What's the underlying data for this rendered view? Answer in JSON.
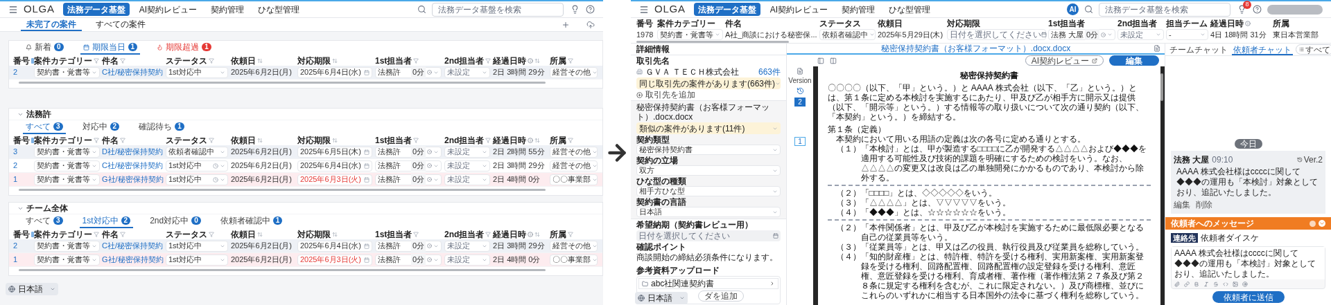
{
  "left": {
    "nav": {
      "logo": "OLGA",
      "menu": [
        {
          "label": "法務データ基盤",
          "selected": true
        },
        {
          "label": "AI契約レビュー",
          "selected": false
        },
        {
          "label": "契約管理",
          "selected": false
        },
        {
          "label": "ひな型管理",
          "selected": false
        }
      ],
      "search": {
        "placeholder": "法務データ基盤を検索"
      }
    },
    "tabs": [
      {
        "label": "未完了の案件",
        "selected": true
      },
      {
        "label": "すべての案件",
        "selected": false
      }
    ],
    "sections": [
      {
        "tabs": [
          {
            "label": "新着",
            "count": "0",
            "kind": "new",
            "selected": false
          },
          {
            "label": "期限当日",
            "count": "1",
            "kind": "today",
            "selected": true
          },
          {
            "label": "期限超過",
            "count": "1",
            "kind": "overdue",
            "selected": false
          }
        ],
        "columns": [
          "番号",
          "案件カテゴリー",
          "件名",
          "ステータス",
          "依頼日",
          "対応期限",
          "1st担当者",
          "2nd担当者",
          "経過日時",
          "所属"
        ],
        "rows": [
          {
            "no": "2",
            "category": "契約書・覚書等",
            "title": "C社/秘密保持契約",
            "status": "1st対応中",
            "status_clock": false,
            "date": "2025年6月2日(月)",
            "deadline": "2025年6月4日(水)",
            "overdue": false,
            "first": "法務許",
            "first_time": "0分",
            "second": "未設定",
            "elapsed": "2日 3時間 29分",
            "dept": "経営その他",
            "selected": true
          }
        ]
      },
      {
        "title": "法務許",
        "tabs": [
          {
            "label": "すべて",
            "count": "3",
            "kind": "plain",
            "selected": true
          },
          {
            "label": "対応中",
            "count": "2",
            "kind": "plain",
            "selected": false
          },
          {
            "label": "確認待ち",
            "count": "1",
            "kind": "plain",
            "selected": false
          }
        ],
        "columns": [
          "番号",
          "案件カテゴリー",
          "件名",
          "ステータス",
          "依頼日",
          "対応期限",
          "1st担当者",
          "2nd担当者",
          "経過日時",
          "所属"
        ],
        "rows": [
          {
            "no": "3",
            "category": "契約書・覚書等",
            "title": "D社/秘密保持契約",
            "status": "依頼者確認中",
            "status_clock": false,
            "date": "2025年6月2日(月)",
            "deadline": "2025年6月5日(木)",
            "overdue": false,
            "first": "法務許",
            "first_time": "0分",
            "second": "未設定",
            "elapsed": "2日 2時間 55分",
            "dept": "経営その他",
            "selected": true
          },
          {
            "no": "2",
            "category": "契約書・覚書等",
            "title": "C社/秘密保持契約",
            "status": "1st対応中",
            "status_clock": true,
            "date": "2025年6月2日(月)",
            "deadline": "2025年6月4日(水)",
            "overdue": false,
            "first": "法務許",
            "first_time": "0分",
            "second": "未設定",
            "elapsed": "2日 3時間 29分",
            "dept": "経営その他",
            "selected": false
          },
          {
            "no": "1",
            "category": "契約書・覚書等",
            "title": "G社/秘密保持契約",
            "status": "1st対応中",
            "status_clock": true,
            "date": "2025年6月2日(月)",
            "deadline": "2025年6月3日(火)",
            "overdue": true,
            "first": "法務許",
            "first_time": "0分",
            "second": "未設定",
            "elapsed": "2日 4時間 0分",
            "dept": "〇〇事業部",
            "selected": false
          }
        ]
      },
      {
        "title": "チーム全体",
        "tabs": [
          {
            "label": "すべて",
            "count": "3",
            "kind": "plain",
            "selected": false
          },
          {
            "label": "1st対応中",
            "count": "2",
            "kind": "plain",
            "selected": true
          },
          {
            "label": "2nd対応中",
            "count": "0",
            "kind": "plain",
            "selected": false
          },
          {
            "label": "依頼者確認中",
            "count": "1",
            "kind": "plain",
            "selected": false
          }
        ],
        "columns": [
          "番号",
          "案件カテゴリー",
          "件名",
          "ステータス",
          "依頼日",
          "対応期限",
          "1st担当者",
          "2nd担当者",
          "経過日時",
          "所属"
        ],
        "rows": [
          {
            "no": "2",
            "category": "契約書・覚書等",
            "title": "C社/秘密保持契約",
            "status": "1st対応中",
            "status_clock": false,
            "date": "2025年6月2日(月)",
            "deadline": "2025年6月4日(水)",
            "overdue": false,
            "first": "法務許",
            "first_time": "0分",
            "second": "未設定",
            "elapsed": "2日 3時間 29分",
            "dept": "経営その他",
            "selected": true
          },
          {
            "no": "1",
            "category": "契約書・覚書等",
            "title": "G社/秘密保持契約",
            "status": "1st対応中",
            "status_clock": false,
            "date": "2025年6月2日(月)",
            "deadline": "2025年6月3日(火)",
            "overdue": true,
            "first": "法務許",
            "first_time": "0分",
            "second": "未設定",
            "elapsed": "2日 4時間 0分",
            "dept": "〇〇事業部",
            "selected": false
          }
        ]
      }
    ],
    "language": "日本語"
  },
  "right": {
    "nav": {
      "logo": "OLGA",
      "menu": [
        {
          "label": "法務データ基盤",
          "selected": true
        },
        {
          "label": "AI契約レビュー",
          "selected": false
        },
        {
          "label": "契約管理",
          "selected": false
        },
        {
          "label": "ひな型管理",
          "selected": false
        }
      ],
      "ai_badge": "AI",
      "search": {
        "placeholder": "法務データ基盤を検索"
      },
      "notifications": "8"
    },
    "case": [
      {
        "label": "番号",
        "value": "1978",
        "kind": "text"
      },
      {
        "label": "案件カテゴリー",
        "value": "契約書・覚書等",
        "kind": "select"
      },
      {
        "label": "件名",
        "value": "A社_商談における秘密保...",
        "kind": "text"
      },
      {
        "label": "ステータス",
        "value": "依頼者確認中",
        "kind": "select"
      },
      {
        "label": "依頼日",
        "value": "2025年5月29日(木)",
        "kind": "text"
      },
      {
        "label": "対応期限",
        "placeholder": "日付を選択してください",
        "kind": "date"
      },
      {
        "label": "1st担当者",
        "value": "法務 大屋",
        "time": "0分",
        "kind": "assignee"
      },
      {
        "label": "2nd担当者",
        "placeholder": "未設定",
        "kind": "empty"
      },
      {
        "label": "担当チーム",
        "value": "-",
        "kind": "select"
      },
      {
        "label": "経過日時",
        "value": "4日 18時間 31分",
        "kind": "elapsed"
      },
      {
        "label": "所属",
        "value": "東日本営業部",
        "kind": "text"
      }
    ],
    "details": {
      "title": "詳細情報",
      "client_label": "取引先名",
      "client": "ＧＶＡ ＴＥＣＨ株式会社",
      "client_count": "663件",
      "client_notice": "同じ取引先の案件があります(663件)",
      "add_client": "取引先を追加",
      "file_name": "秘密保持契約書（お客様フォーマット）.docx.docx",
      "similar_notice": "類似の案件があります(11件)",
      "selects": [
        {
          "label": "契約類型",
          "value": "秘密保持契約書"
        },
        {
          "label": "契約の立場",
          "value": "双方"
        },
        {
          "label": "ひな型の種類",
          "value": "相手方ひな型"
        },
        {
          "label": "契約書の言語",
          "value": "日本語"
        }
      ],
      "due": {
        "label": "希望納期（契約書レビュー用）",
        "placeholder": "日付を選択してください"
      },
      "points": {
        "label": "確認ポイント",
        "text": "商談開始の締結必須条件になります。"
      },
      "upload": {
        "label": "参考資料アップロード",
        "folder": "abc社関連契約書",
        "add_folder": "ダを追加"
      }
    },
    "document": {
      "file_title": "秘密保持契約書（お客様フォーマット）.docx.docx",
      "version_label": "Version",
      "versions": [
        {
          "label": "2",
          "selected": true
        },
        {
          "label": "1",
          "selected": false
        }
      ],
      "ai_review": "AI契約レビュー",
      "edit": "編集",
      "title": "秘密保持契約書",
      "paragraphs": [
        {
          "kind": "body",
          "text": "〇〇〇〇（以下、「甲」という。）と AAAA 株式会社（以下、「乙」という。）とは、第１条に定める本検討を実施するにあたり、甲及び乙が相手方に開示又は提供（以下、「開示等」という。）する情報等の取り扱いについて次の通り契約（以下、「本契約」という。）を締結する。"
        },
        {
          "kind": "heading",
          "text": "第１条（定義）"
        },
        {
          "kind": "indent",
          "text": "本契約において用いる用語の定義は次の各号に定める通りとする。"
        },
        {
          "kind": "item",
          "text": "（１）「本検討」とは、甲が製造する□□□□に乙が開発する△△△△および◆◆◆を適用する可能性及び技術的課題を明確にするための検討をいう。なお、△△△△の変更又は改良は乙の単独開発にかかるものであり、本検討から除外する。"
        },
        {
          "kind": "rule"
        },
        {
          "kind": "item",
          "text": "（２）「□□□□」とは、◇◇◇◇◇をいう。"
        },
        {
          "kind": "item",
          "text": "（３）「△△△△」とは、▽▽▽▽▽をいう。"
        },
        {
          "kind": "item",
          "text": "（４）「◆◆◆」とは、☆☆☆☆☆☆をいう。"
        },
        {
          "kind": "rule"
        },
        {
          "kind": "item",
          "text": "（２）「本件関係者」とは、甲及び乙が本検討を実施するために最低限必要となる自己の従業員等をいう。"
        },
        {
          "kind": "item",
          "text": "（３）「従業員等」とは、甲又は乙の役員、執行役員及び従業員を総称していう。"
        },
        {
          "kind": "item",
          "text": "（４）「知的財産権」とは、特許権、特許を受ける権利、実用新案権、実用新案登録を受ける権利、回路配置権、回路配置権の設定登録を受ける権利、意匠権、意匠登録を受ける権利、育成者権、著作権（著作権法第２７条及び第２８条に規定する権利を含むが、これに限定されない。）及び商標権、並びにこれらのいずれかに相当する日本国外の法令に基づく権利を総称していう。"
        }
      ]
    },
    "chat": {
      "tabs": [
        {
          "label": "チームチャット",
          "selected": false
        },
        {
          "label": "依頼者チャット",
          "selected": true
        }
      ],
      "filter": "すべて",
      "date": "今日",
      "messages": [
        {
          "author": "法務 大屋",
          "time": "09:10",
          "version": "Ver.2",
          "text": "AAAA 株式会社様はccccに関して◆◆◆の運用も「本検討」対象としており、追記いたしました。",
          "actions": [
            "編集",
            "削除"
          ]
        }
      ],
      "composer": {
        "title": "依頼者へのメッセージ",
        "tag": "連絡先",
        "recipient": "依頼者ダイスケ",
        "value": "AAAA 株式会社様はccccに関して◆◆◆の運用も「本検討」対象としており、追記いたしました。",
        "send": "依頼者に送信"
      }
    },
    "language": "日本語"
  }
}
